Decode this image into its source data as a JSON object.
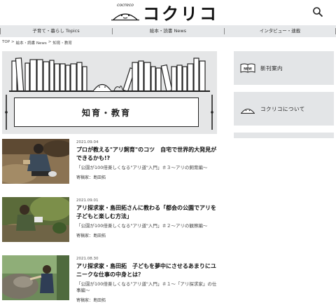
{
  "header": {
    "logo_text": "コクリコ",
    "logo_tag": "cocreco"
  },
  "nav": {
    "items": [
      {
        "label": "子育て・暮らし Topics"
      },
      {
        "label": "絵本・読書 News"
      },
      {
        "label": "インタビュー・連載"
      }
    ]
  },
  "breadcrumb": {
    "items": [
      "TOP",
      "絵本・読書 News",
      "知育・教育"
    ],
    "separator": ">"
  },
  "hero": {
    "title": "知育・教育"
  },
  "articles": [
    {
      "date": "2021.09.04",
      "title": "プロが教える\"アリ飼育\"のコツ　自宅で世界的大発見ができるかも!?",
      "series": "「公園が100倍楽しくなる\"アリ道\"入門」＃３〜アリの飼育編〜",
      "author": "寄稿家：島田拓"
    },
    {
      "date": "2021.09.01",
      "title": "アリ探求家・島田拓さんに教わる「都会の公園でアリを子どもと楽しむ方法」",
      "series": "「公園が100倍楽しくなる\"アリ道\"入門」＃２〜アリの観察編〜",
      "author": "寄稿家：島田拓"
    },
    {
      "date": "2021.08.30",
      "title": "アリ探求家・島田拓　子どもを夢中にさせるあまりにユニークな仕事の中身とは？",
      "series": "「公園が100倍楽しくなる\"アリ道\"入門」＃１〜「アリ探求家」の仕事編〜",
      "author": "寄稿家：島田拓"
    }
  ],
  "sidebar": {
    "new_books_label": "新刊案内",
    "about_label": "コクリコについて",
    "new_badge": "NEW"
  }
}
